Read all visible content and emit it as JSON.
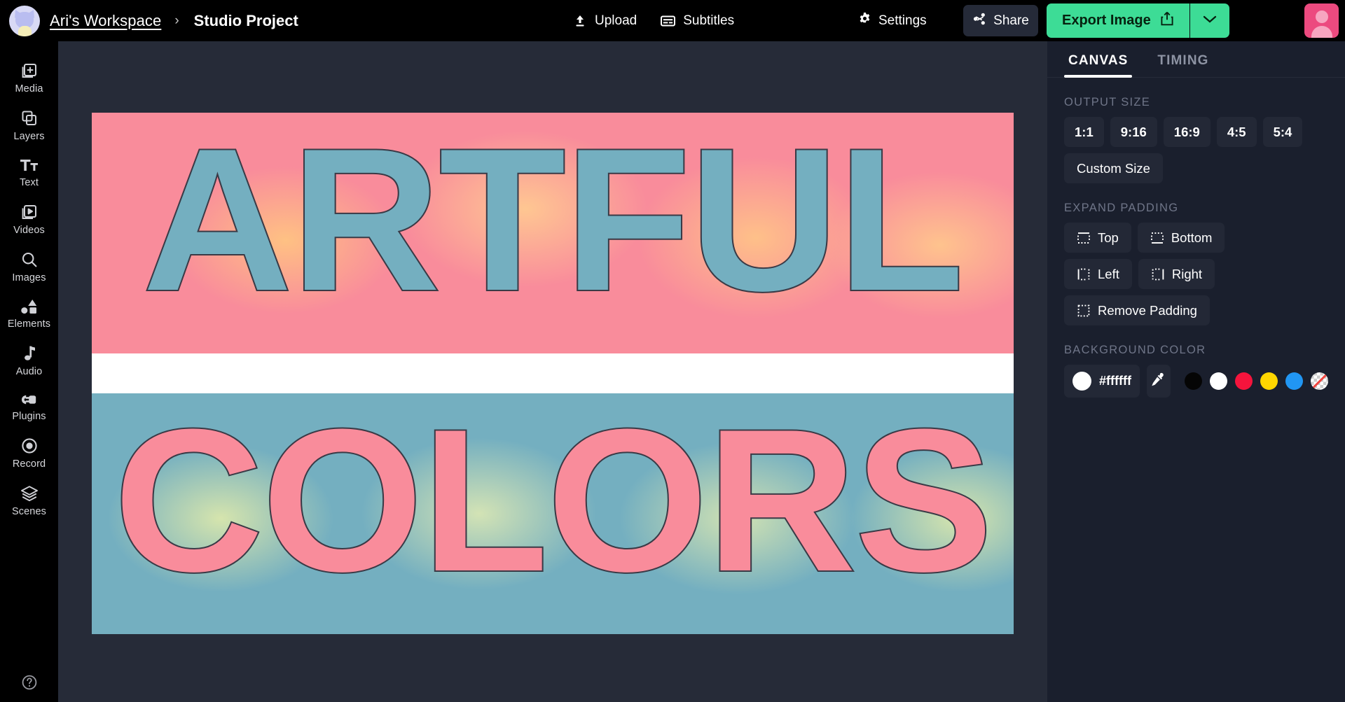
{
  "topbar": {
    "avatar_name": "workspace-avatar",
    "workspace": "Ari's Workspace",
    "separator": "›",
    "project": "Studio Project",
    "upload_label": "Upload",
    "subtitles_label": "Subtitles",
    "settings_label": "Settings",
    "share_label": "Share",
    "export_label": "Export Image",
    "export_caret": "⌄"
  },
  "sidebar": {
    "items": [
      {
        "icon": "media-icon",
        "label": "Media"
      },
      {
        "icon": "layers-icon",
        "label": "Layers"
      },
      {
        "icon": "text-icon",
        "label": "Text"
      },
      {
        "icon": "videos-icon",
        "label": "Videos"
      },
      {
        "icon": "images-icon",
        "label": "Images"
      },
      {
        "icon": "elements-icon",
        "label": "Elements"
      },
      {
        "icon": "audio-icon",
        "label": "Audio"
      },
      {
        "icon": "plugins-icon",
        "label": "Plugins"
      },
      {
        "icon": "record-icon",
        "label": "Record"
      },
      {
        "icon": "scenes-icon",
        "label": "Scenes"
      }
    ],
    "help_icon": "help-circle-icon"
  },
  "canvas": {
    "top_text": "ARTFUL",
    "bottom_text": "COLORS",
    "top_band_bg": "#f98c9b",
    "top_text_fill": "#74afc0",
    "top_glow": "#ffc98c",
    "divider_color": "#ffffff",
    "bottom_band_bg": "#74afc0",
    "bottom_text_fill": "#f98c9b",
    "bottom_glow": "#e7eeaa",
    "stroke_color": "#3a3a46"
  },
  "panel": {
    "tabs": [
      {
        "label": "CANVAS",
        "active": true
      },
      {
        "label": "TIMING",
        "active": false
      }
    ],
    "output_size": {
      "label": "OUTPUT SIZE",
      "ratios": [
        "1:1",
        "9:16",
        "16:9",
        "4:5",
        "5:4"
      ],
      "custom_label": "Custom Size"
    },
    "expand_padding": {
      "label": "EXPAND PADDING",
      "buttons": [
        {
          "icon": "padding-top-icon",
          "label": "Top"
        },
        {
          "icon": "padding-bottom-icon",
          "label": "Bottom"
        },
        {
          "icon": "padding-left-icon",
          "label": "Left"
        },
        {
          "icon": "padding-right-icon",
          "label": "Right"
        },
        {
          "icon": "padding-remove-icon",
          "label": "Remove Padding"
        }
      ]
    },
    "background_color": {
      "label": "BACKGROUND COLOR",
      "current_hex": "#ffffff",
      "eyedropper_icon": "eyedropper-icon",
      "swatches": [
        {
          "name": "black",
          "hex": "#050505"
        },
        {
          "name": "white",
          "hex": "#ffffff"
        },
        {
          "name": "red",
          "hex": "#f5143c"
        },
        {
          "name": "yellow",
          "hex": "#ffd600"
        },
        {
          "name": "blue",
          "hex": "#2196f3"
        },
        {
          "name": "transparent",
          "hex": "transparent"
        }
      ]
    }
  }
}
